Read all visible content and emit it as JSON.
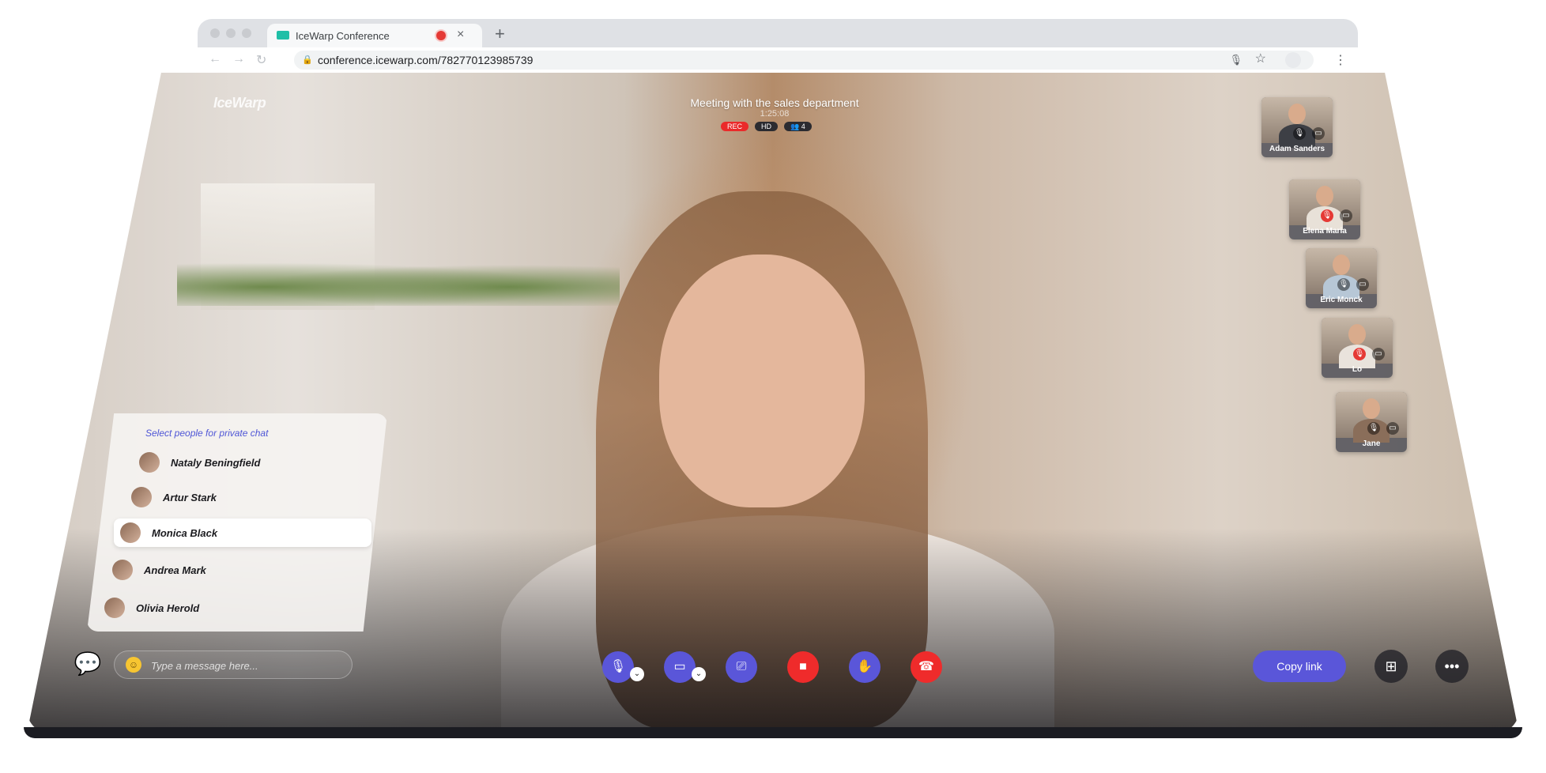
{
  "browser": {
    "tab_title": "IceWarp Conference",
    "new_tab": "+",
    "close_glyph": "×",
    "url": "conference.icewarp.com/782770123985739"
  },
  "meeting": {
    "logo": "IceWarp",
    "title": "Meeting with the sales department",
    "time": "1:25:08",
    "badges": {
      "rec": "REC",
      "hd": "HD",
      "people": "4"
    }
  },
  "participants": [
    {
      "name": "Adam Sanders",
      "mic_muted": false
    },
    {
      "name": "Elena Maria",
      "mic_muted": true
    },
    {
      "name": "Eric Monck",
      "mic_muted": false
    },
    {
      "name": "Lo",
      "mic_muted": true
    },
    {
      "name": "Jane",
      "mic_muted": false
    }
  ],
  "private_chat": {
    "header": "Select people for private chat",
    "people": [
      "Nataly Beningfield",
      "Artur Stark",
      "Monica Black",
      "Andrea Mark",
      "Olivia Herold"
    ],
    "selected": "Monica Black"
  },
  "message": {
    "placeholder": "Type a message here..."
  },
  "controls": {
    "copy_link": "Copy link"
  },
  "colors": {
    "accent": "#5a56d9",
    "danger": "#ef2b2b"
  }
}
